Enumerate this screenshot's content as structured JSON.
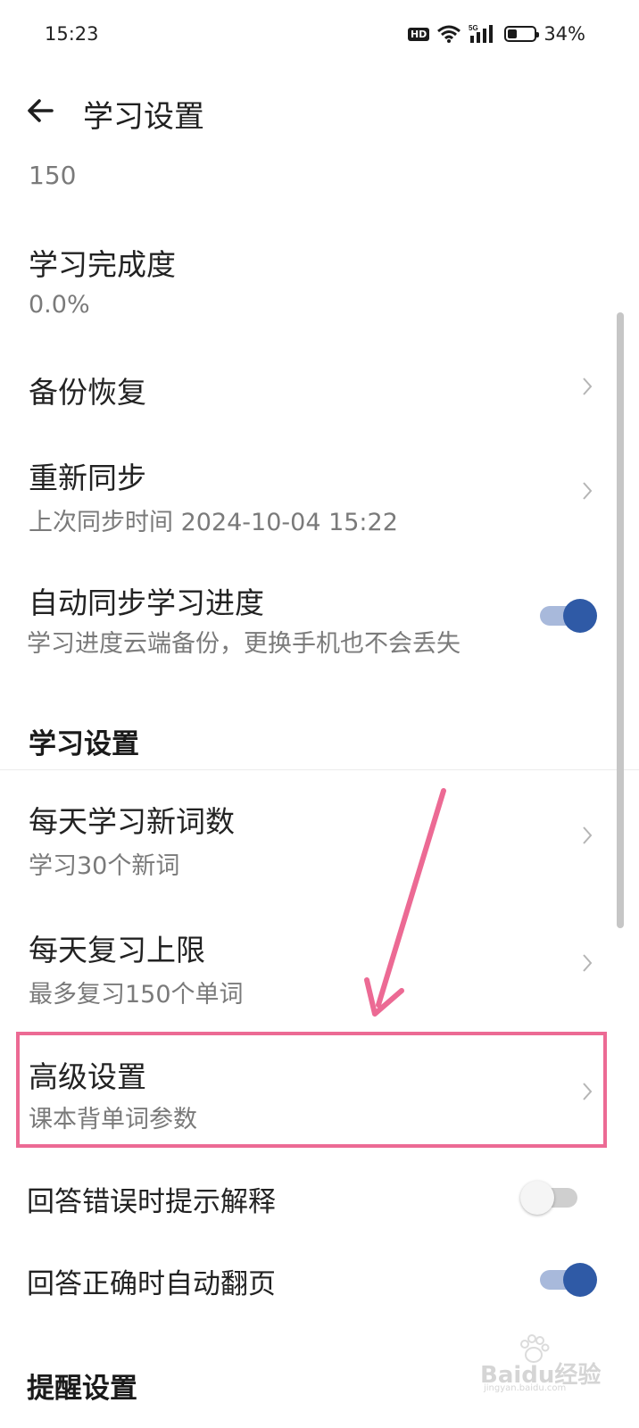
{
  "status_bar": {
    "time": "15:23",
    "hd": "HD",
    "network": "5G",
    "battery_percent_text": "34%",
    "battery_level": 0.34
  },
  "app_bar": {
    "back_icon": "back-arrow-icon",
    "title": "学习设置"
  },
  "rows": {
    "partial_value": "150",
    "completion": {
      "title": "学习完成度",
      "value": "0.0%"
    },
    "backup": {
      "title": "备份恢复"
    },
    "resync": {
      "title": "重新同步",
      "subtitle": "上次同步时间 2024-10-04 15:22"
    },
    "auto_sync": {
      "title": "自动同步学习进度",
      "subtitle": "学习进度云端备份，更换手机也不会丢失",
      "enabled": true
    }
  },
  "study_section": {
    "header": "学习设置",
    "daily_new": {
      "title": "每天学习新词数",
      "subtitle": "学习30个新词"
    },
    "daily_review": {
      "title": "每天复习上限",
      "subtitle": "最多复习150个单词"
    },
    "advanced": {
      "title": "高级设置",
      "subtitle": "课本背单词参数"
    },
    "hint_on_wrong": {
      "title": "回答错误时提示解释",
      "enabled": false
    },
    "auto_page": {
      "title": "回答正确时自动翻页",
      "enabled": true
    }
  },
  "reminder_section": {
    "header": "提醒设置"
  },
  "annotation": {
    "highlight_color": "#ec6a94",
    "accent_color": "#2f5aa6"
  },
  "watermark": {
    "brand": "Baidu经验",
    "site": "jingyan.baidu.com"
  }
}
